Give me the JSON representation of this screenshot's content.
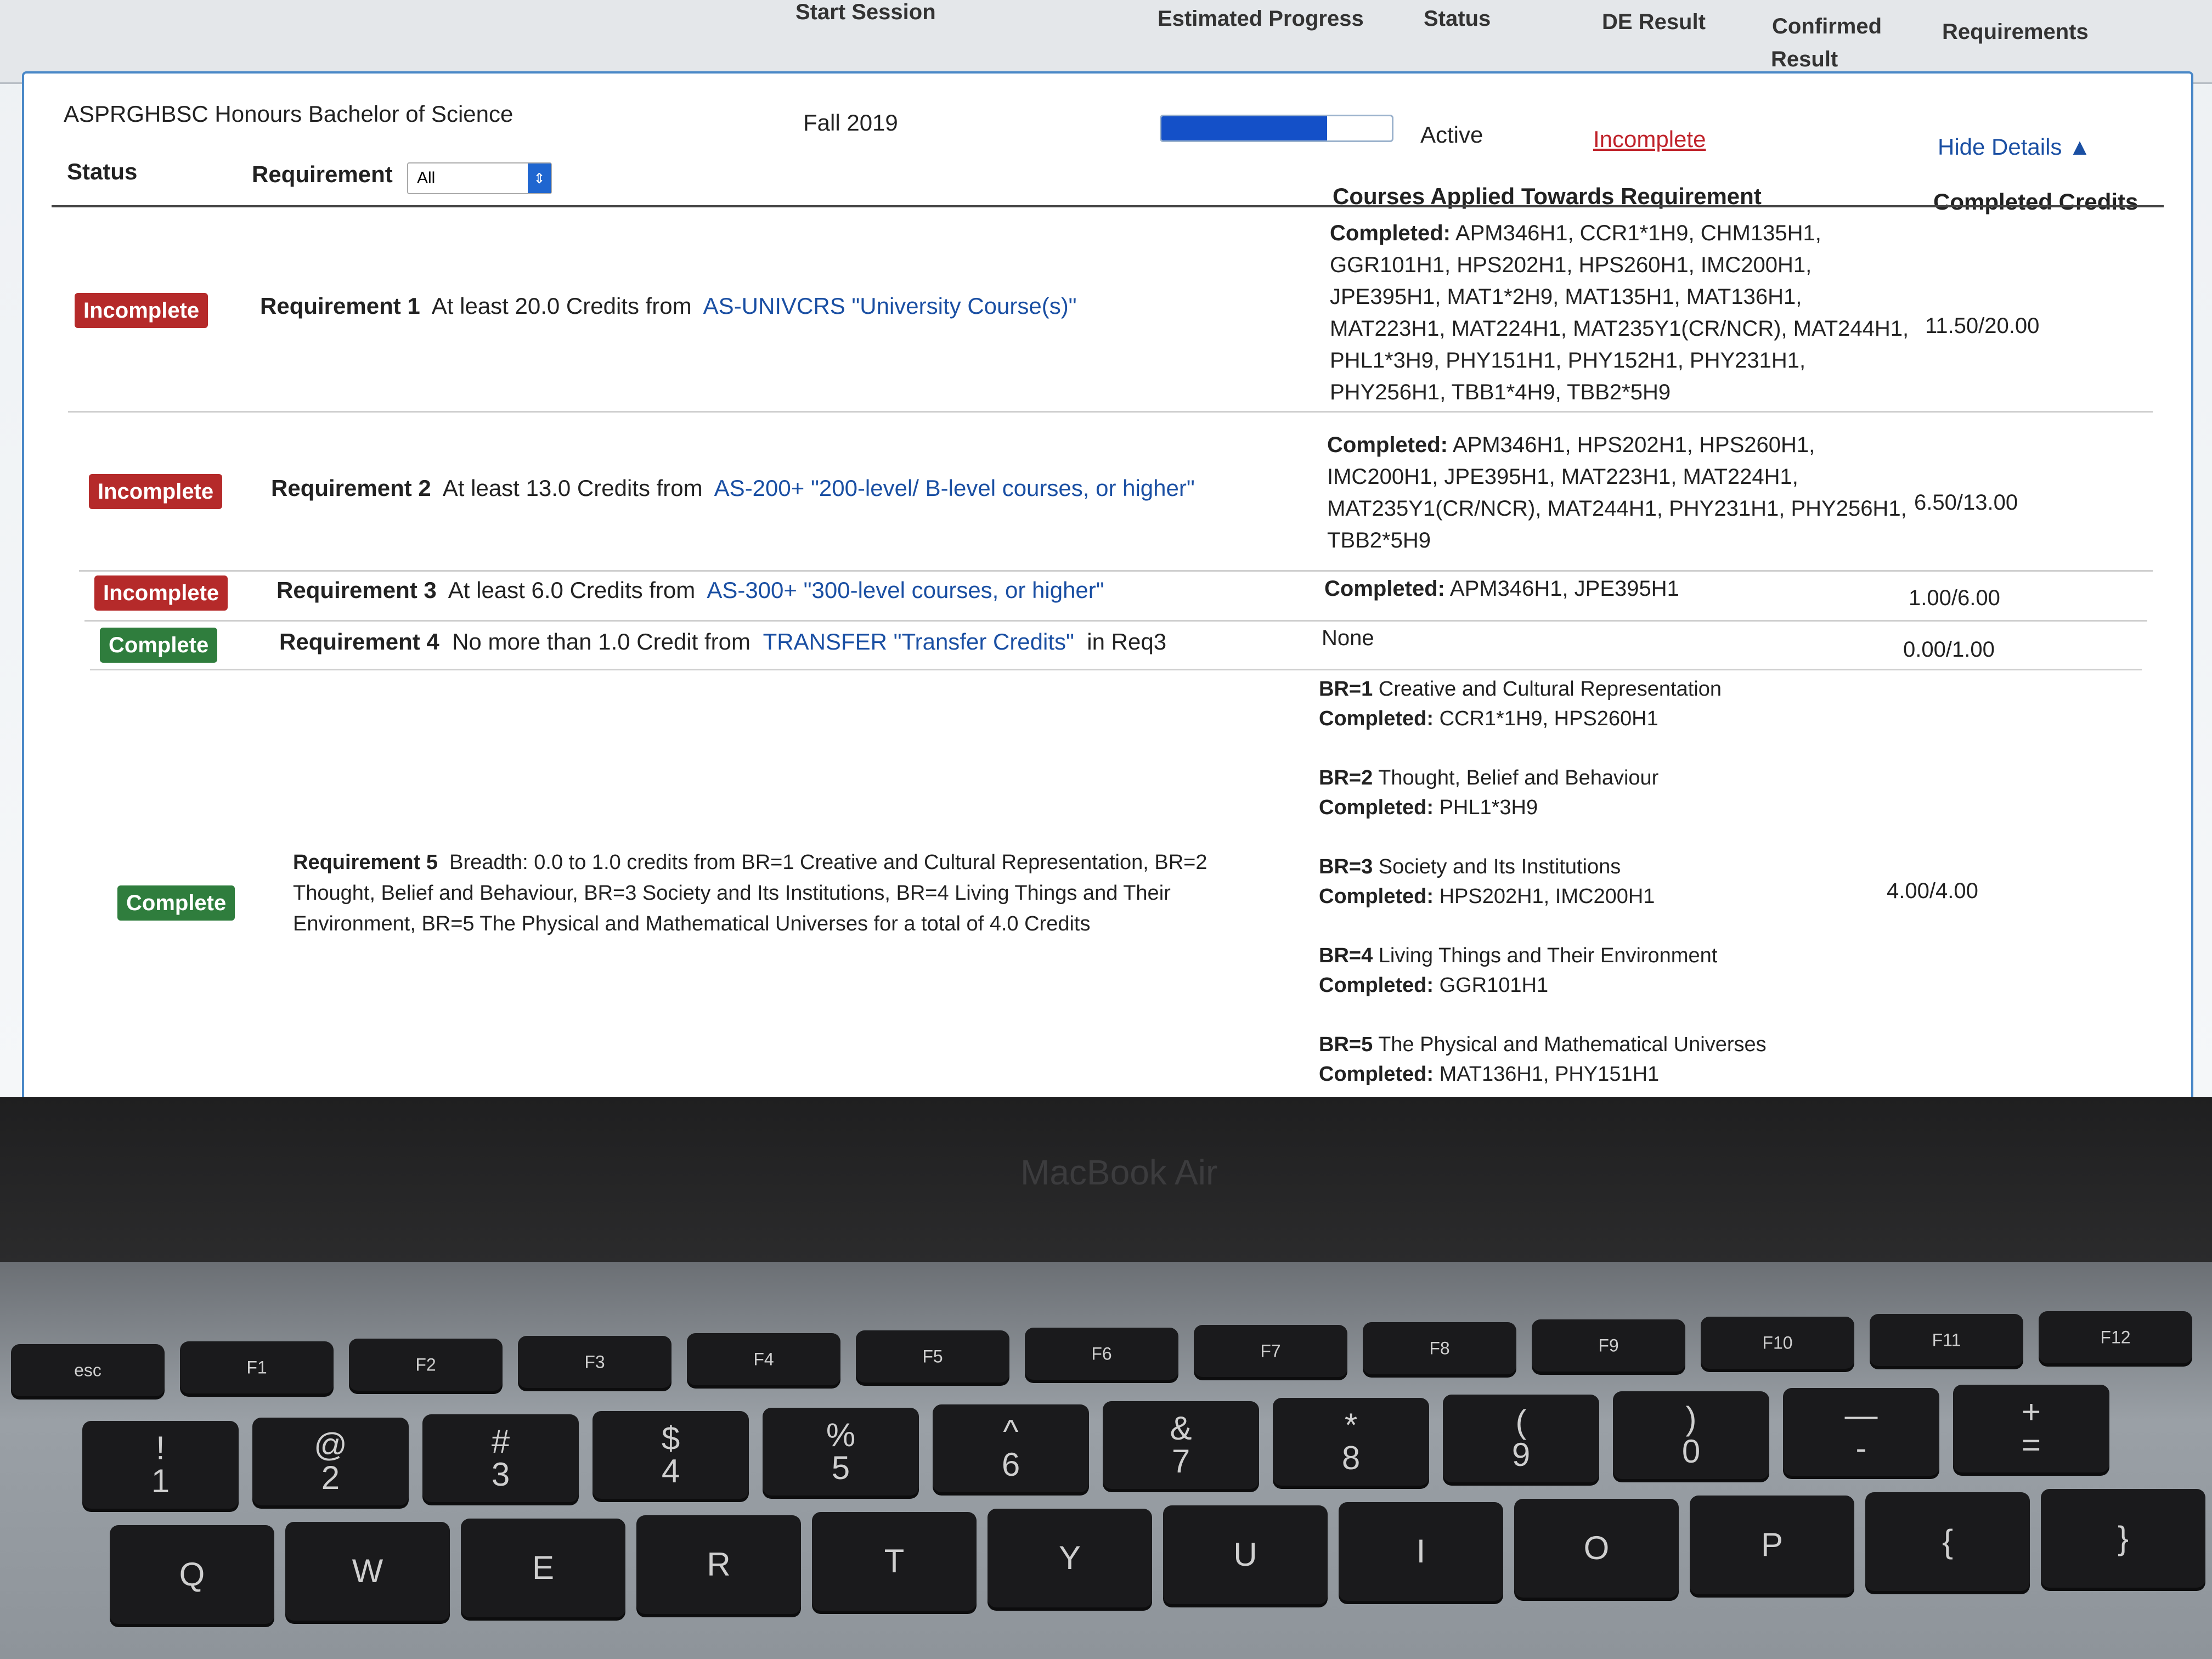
{
  "header": {
    "start_session": "Start Session",
    "estimated_progress": "Estimated Progress",
    "status": "Status",
    "de_result": "DE Result",
    "confirmed_result_line1": "Confirmed",
    "confirmed_result_line2": "Result",
    "requirements": "Requirements"
  },
  "program": {
    "title": "ASPRGHBSC Honours Bachelor of Science",
    "session": "Fall 2019",
    "progress_fraction": 0.72,
    "status": "Active",
    "result": "Incomplete",
    "hide_details": "Hide Details ▲"
  },
  "table": {
    "col_status": "Status",
    "col_requirement": "Requirement",
    "filter_value": "All",
    "col_courses": "Courses Applied Towards Requirement",
    "col_credits": "Completed Credits"
  },
  "requirements": [
    {
      "status": "Incomplete",
      "label": "Requirement 1",
      "text": "At least 20.0 Credits from",
      "link": "AS-UNIVCRS \"University Course(s)\"",
      "courses_label": "Completed:",
      "courses_lines": [
        "APM346H1, CCR1*1H9, CHM135H1,",
        "GGR101H1, HPS202H1, HPS260H1, IMC200H1,",
        "JPE395H1, MAT1*2H9, MAT135H1, MAT136H1,",
        "MAT223H1, MAT224H1, MAT235Y1(CR/NCR), MAT244H1,",
        "PHL1*3H9, PHY151H1, PHY152H1, PHY231H1,",
        "PHY256H1, TBB1*4H9, TBB2*5H9"
      ],
      "credits": "11.50/20.00"
    },
    {
      "status": "Incomplete",
      "label": "Requirement 2",
      "text": "At least 13.0 Credits from",
      "link": "AS-200+ \"200-level/ B-level courses, or higher\"",
      "courses_label": "Completed:",
      "courses_lines": [
        "APM346H1, HPS202H1, HPS260H1,",
        "IMC200H1, JPE395H1, MAT223H1, MAT224H1,",
        "MAT235Y1(CR/NCR), MAT244H1, PHY231H1, PHY256H1,",
        "TBB2*5H9"
      ],
      "credits": "6.50/13.00"
    },
    {
      "status": "Incomplete",
      "label": "Requirement 3",
      "text": "At least 6.0 Credits from",
      "link": "AS-300+ \"300-level courses, or higher\"",
      "courses_label": "Completed:",
      "courses_lines": [
        "APM346H1, JPE395H1"
      ],
      "credits": "1.00/6.00"
    },
    {
      "status": "Complete",
      "label": "Requirement 4",
      "text": "No more than 1.0 Credit from",
      "link": "TRANSFER \"Transfer Credits\"",
      "suffix": "in Req3",
      "courses_label": "",
      "courses_lines": [
        "None"
      ],
      "credits": "0.00/1.00"
    },
    {
      "status": "Complete",
      "label": "Requirement 5",
      "text_lines": [
        "Breadth: 0.0 to 1.0 credits from BR=1 Creative and Cultural Representation, BR=2",
        "Thought, Belief and Behaviour, BR=3 Society and Its Institutions, BR=4 Living Things and Their",
        "Environment, BR=5 The Physical and Mathematical Universes for a total of 4.0 Credits"
      ],
      "breadth": [
        {
          "code": "BR=1",
          "name": "Creative and Cultural Representation",
          "completed_label": "Completed:",
          "completed": "CCR1*1H9, HPS260H1"
        },
        {
          "code": "BR=2",
          "name": "Thought, Belief and Behaviour",
          "completed_label": "Completed:",
          "completed": "PHL1*3H9"
        },
        {
          "code": "BR=3",
          "name": "Society and Its Institutions",
          "completed_label": "Completed:",
          "completed": "HPS202H1, IMC200H1"
        },
        {
          "code": "BR=4",
          "name": "Living Things and Their Environment",
          "completed_label": "Completed:",
          "completed": "GGR101H1"
        },
        {
          "code": "BR=5",
          "name": "The Physical and Mathematical Universes",
          "completed_label": "Completed:",
          "completed": "MAT136H1, PHY151H1"
        }
      ],
      "credits": "4.00/4.00"
    }
  ],
  "device": {
    "brand": "MacBook Air"
  },
  "keyboard": {
    "fn_row": [
      "esc",
      "F1",
      "F2",
      "F3",
      "F4",
      "F5",
      "F6",
      "F7",
      "F8",
      "F9",
      "F10",
      "F11",
      "F12"
    ],
    "num_row_top": [
      "!",
      "@",
      "#",
      "$",
      "%",
      "^",
      "&",
      "*",
      "(",
      ")",
      "—",
      "+"
    ],
    "num_row_bottom": [
      "1",
      "2",
      "3",
      "4",
      "5",
      "6",
      "7",
      "8",
      "9",
      "0",
      "-",
      "="
    ],
    "letter_row": [
      "Q",
      "W",
      "E",
      "R",
      "T",
      "Y",
      "U",
      "I",
      "O",
      "P",
      "{",
      "}"
    ]
  }
}
